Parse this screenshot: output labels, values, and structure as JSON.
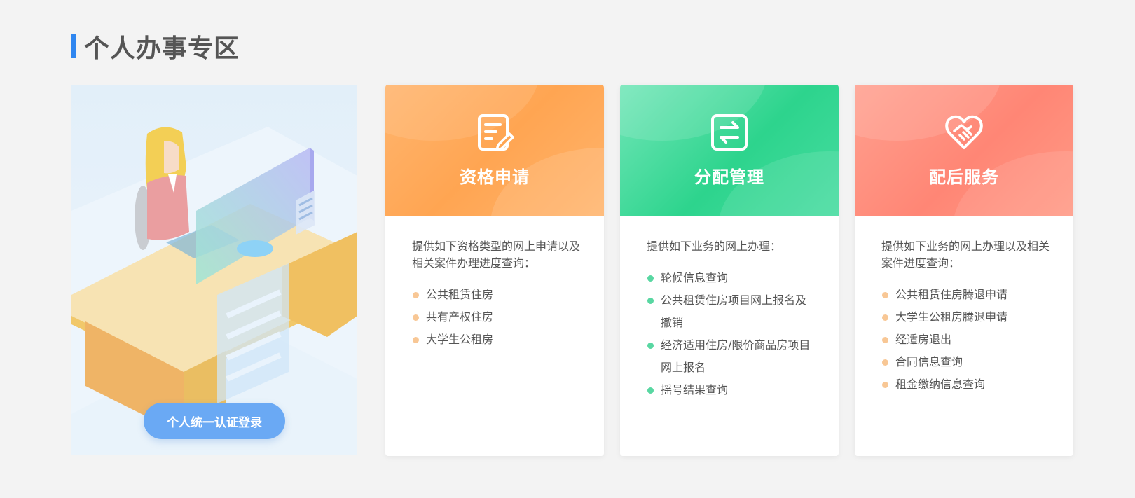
{
  "section": {
    "title": "个人办事专区"
  },
  "hero": {
    "login_label": "个人统一认证登录"
  },
  "cards": [
    {
      "title": "资格申请",
      "icon": "edit-document-icon",
      "desc": "提供如下资格类型的网上申请以及相关案件办理进度查询：",
      "items": [
        "公共租赁住房",
        "共有产权住房",
        "大学生公租房"
      ],
      "dot_color": "#f8c795"
    },
    {
      "title": "分配管理",
      "icon": "swap-arrows-icon",
      "desc": "提供如下业务的网上办理：",
      "items": [
        "轮候信息查询",
        "公共租赁住房项目网上报名及撤销",
        "经济适用住房/限价商品房项目网上报名",
        "摇号结果查询"
      ],
      "dot_color": "#59d7a2"
    },
    {
      "title": "配后服务",
      "icon": "heart-handshake-icon",
      "desc": "提供如下业务的网上办理以及相关案件进度查询：",
      "items": [
        "公共租赁住房腾退申请",
        "大学生公租房腾退申请",
        "经适房退出",
        "合同信息查询",
        "租金缴纳信息查询"
      ],
      "dot_color": "#f8c795"
    }
  ],
  "colors": {
    "accent": "#2f86f0",
    "orange": "#ffa552",
    "green": "#2dd48d",
    "red": "#ff8675",
    "login_button": "#6aa9f4"
  }
}
